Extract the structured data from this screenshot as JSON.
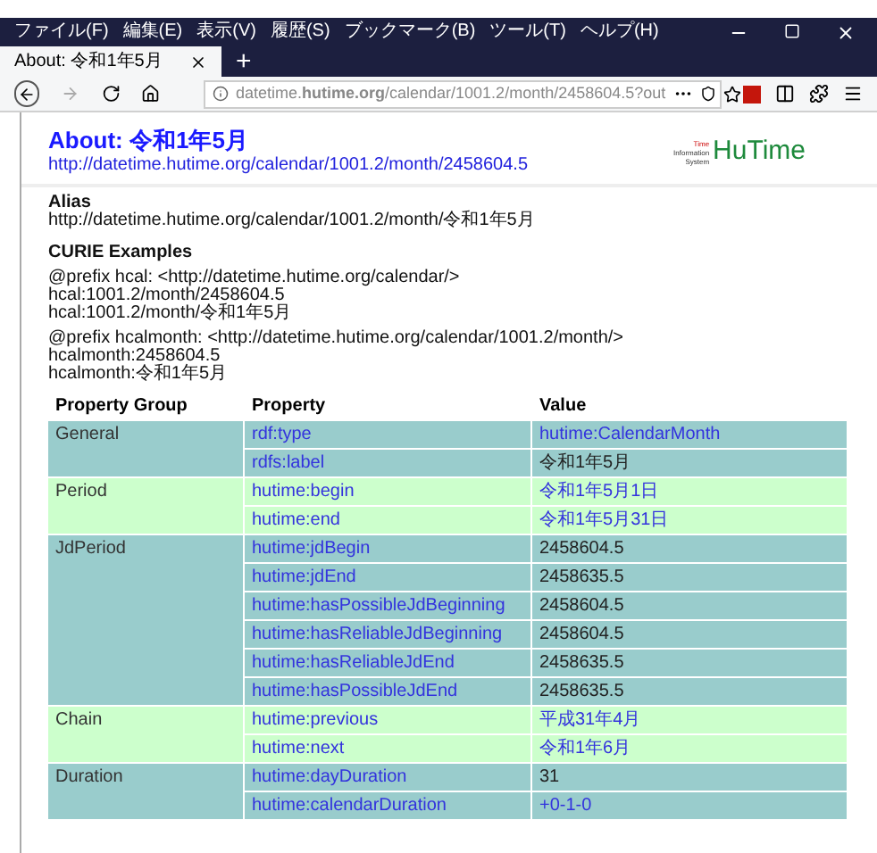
{
  "menu_bar": {
    "items": [
      "ファイル(F)",
      "編集(E)",
      "表示(V)",
      "履歴(S)",
      "ブックマーク(B)",
      "ツール(T)",
      "ヘルプ(H)"
    ]
  },
  "tab": {
    "title": "About: 令和1年5月",
    "selected": true
  },
  "new_tab": "+",
  "address_bar": {
    "url": "datetime.**hutime.org**/calendar/1001.2/month/2458604.5?out"
  },
  "page_header": {
    "title": "About: 令和1年5月",
    "url": "http://datetime.hutime.org/calendar/1001.2/month/2458604.5",
    "logo": {
      "caption": [
        "Time",
        "Information",
        "System"
      ],
      "name": "HuTime"
    }
  },
  "alias": {
    "heading": "Alias",
    "text": "http://datetime.hutime.org/calendar/1001.2/month/令和1年5月"
  },
  "curie_examples": {
    "heading": "CURIE Examples",
    "blocks": [
      [
        "@prefix hcal: <http://datetime.hutime.org/calendar/>",
        "hcal:1001.2/month/2458604.5",
        "hcal:1001.2/month/令和1年5月"
      ],
      [
        "@prefix hcalmonth: <http://datetime.hutime.org/calendar/1001.2/month/>",
        "hcalmonth:2458604.5",
        "hcalmonth:令和1年5月"
      ]
    ]
  },
  "table": {
    "columns": [
      "Property Group",
      "Property",
      "Value"
    ],
    "groups": [
      {
        "name": "General",
        "color": "#99cccc",
        "rows": [
          {
            "property": "rdf:type",
            "value": "hutime:CalendarMonth",
            "kind": "link"
          },
          {
            "property": "rdfs:label",
            "value": "令和1年5月",
            "kind": "literal"
          }
        ]
      },
      {
        "name": "Period",
        "color": "#ccffcc",
        "rows": [
          {
            "property": "hutime:begin",
            "value": "令和1年5月1日",
            "kind": "link"
          },
          {
            "property": "hutime:end",
            "value": "令和1年5月31日",
            "kind": "link"
          }
        ]
      },
      {
        "name": "JdPeriod",
        "color": "#99cccc",
        "rows": [
          {
            "property": "hutime:jdBegin",
            "value": "2458604.5",
            "kind": "literal"
          },
          {
            "property": "hutime:jdEnd",
            "value": "2458635.5",
            "kind": "literal"
          },
          {
            "property": "hutime:hasPossibleJdBeginning",
            "value": "2458604.5",
            "kind": "literal"
          },
          {
            "property": "hutime:hasReliableJdBeginning",
            "value": "2458604.5",
            "kind": "literal"
          },
          {
            "property": "hutime:hasReliableJdEnd",
            "value": "2458635.5",
            "kind": "literal"
          },
          {
            "property": "hutime:hasPossibleJdEnd",
            "value": "2458635.5",
            "kind": "literal"
          }
        ]
      },
      {
        "name": "Chain",
        "color": "#ccffcc",
        "rows": [
          {
            "property": "hutime:previous",
            "value": "平成31年4月",
            "kind": "link"
          },
          {
            "property": "hutime:next",
            "value": "令和1年6月",
            "kind": "link"
          }
        ]
      },
      {
        "name": "Duration",
        "color": "#99cccc",
        "rows": [
          {
            "property": "hutime:dayDuration",
            "value": "31",
            "kind": "literal"
          },
          {
            "property": "hutime:calendarDuration",
            "value": "+0-1-0",
            "kind": "link"
          }
        ]
      }
    ]
  }
}
